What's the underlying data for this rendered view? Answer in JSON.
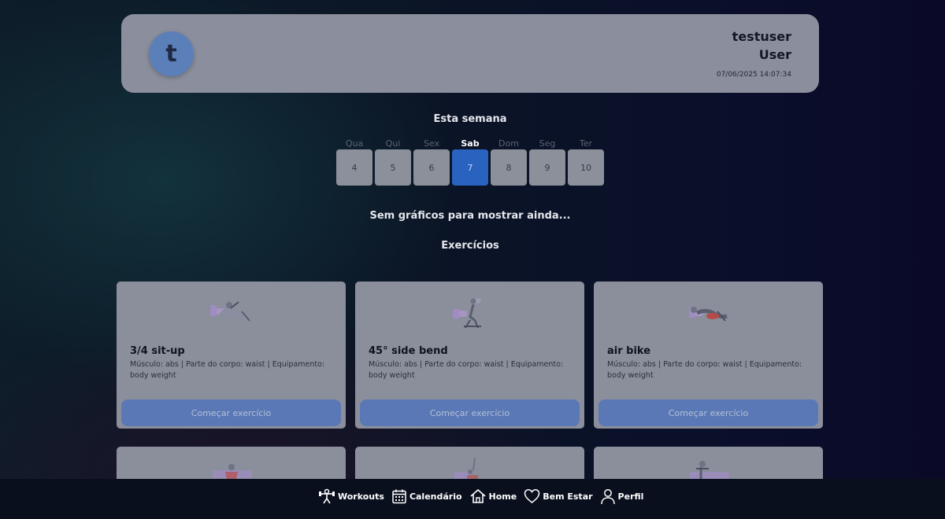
{
  "header": {
    "avatar_letter": "t",
    "username": "testuser",
    "role": "User",
    "datetime": "07/06/2025 14:07:34"
  },
  "week": {
    "title": "Esta semana",
    "days": [
      {
        "name": "Qua",
        "number": "4",
        "active": false
      },
      {
        "name": "Qui",
        "number": "5",
        "active": false
      },
      {
        "name": "Sex",
        "number": "6",
        "active": false
      },
      {
        "name": "Sab",
        "number": "7",
        "active": true
      },
      {
        "name": "Dom",
        "number": "8",
        "active": false
      },
      {
        "name": "Seg",
        "number": "9",
        "active": false
      },
      {
        "name": "Ter",
        "number": "10",
        "active": false
      }
    ]
  },
  "charts_empty_message": "Sem gráficos para mostrar ainda...",
  "exercises": {
    "title": "Exercícios",
    "cards": [
      {
        "name": "3/4 sit-up",
        "description": "Músculo: abs | Parte do corpo: waist | Equipamento: body weight",
        "button": "Começar exercício"
      },
      {
        "name": "45° side bend",
        "description": "Músculo: abs | Parte do corpo: waist | Equipamento: body weight",
        "button": "Começar exercício"
      },
      {
        "name": "air bike",
        "description": "Músculo: abs | Parte do corpo: waist | Equipamento: body weight",
        "button": "Começar exercício"
      }
    ]
  },
  "nav": {
    "items": [
      {
        "label": "Workouts",
        "icon": "dumbbell-person-icon"
      },
      {
        "label": "Calendário",
        "icon": "calendar-icon"
      },
      {
        "label": "Home",
        "icon": "home-icon"
      },
      {
        "label": "Bem Estar",
        "icon": "heart-icon"
      },
      {
        "label": "Perfil",
        "icon": "person-icon"
      }
    ]
  },
  "colors": {
    "accent": "#2a62c0",
    "card_bg": "#8b8f9b",
    "button_bg": "#5a78b5"
  }
}
